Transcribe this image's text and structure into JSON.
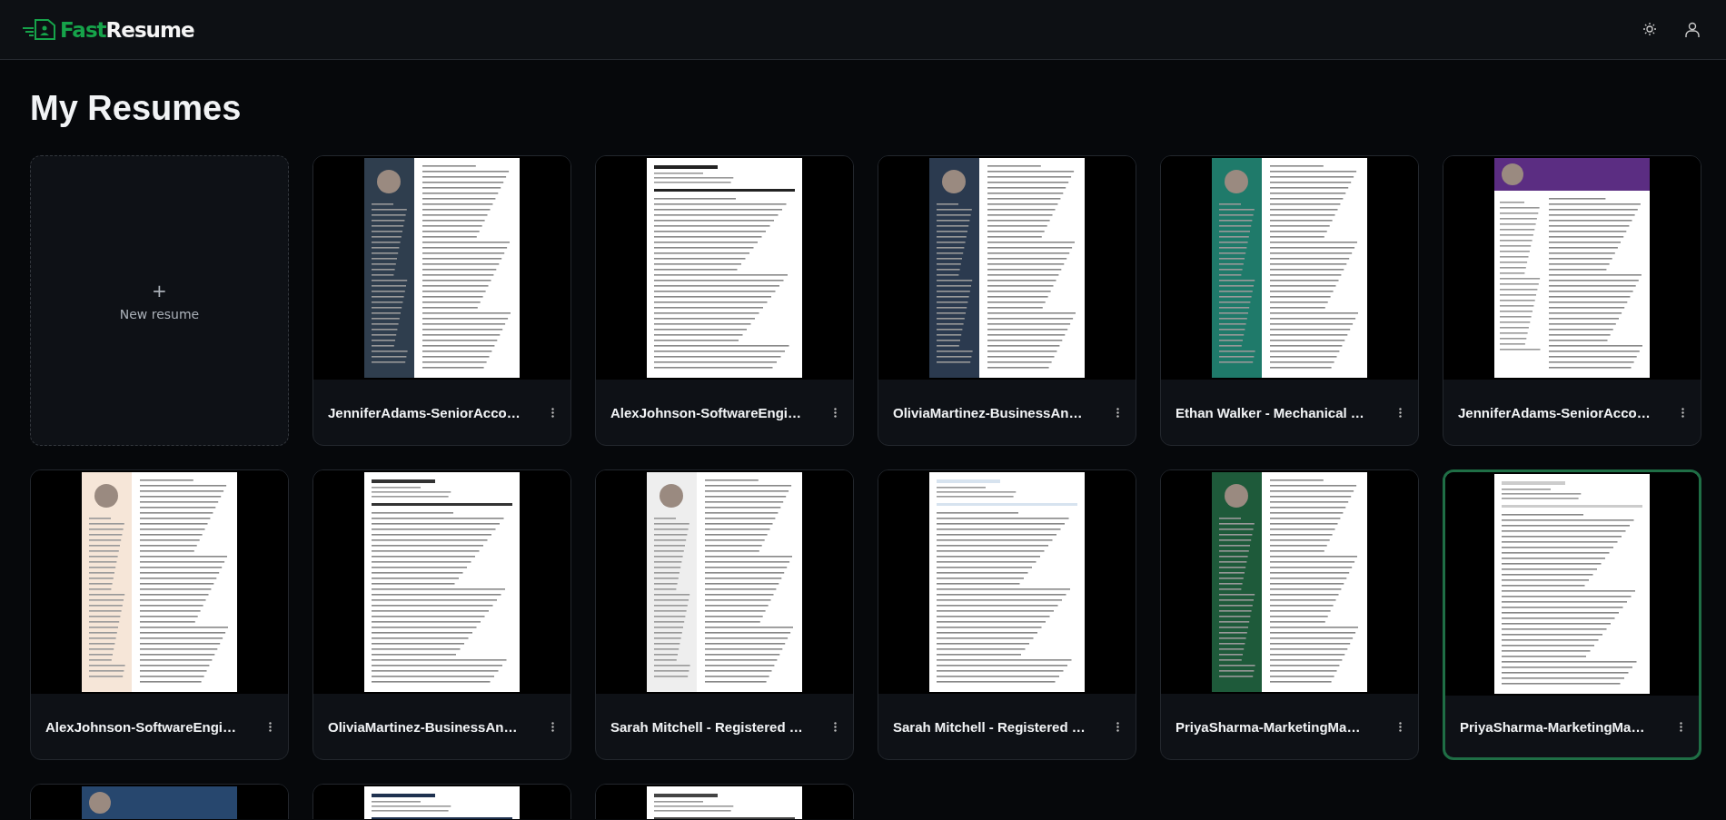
{
  "app": {
    "logo_part_1": "Fast",
    "logo_part_2": "Resume"
  },
  "page": {
    "title": "My Resumes"
  },
  "new_card": {
    "plus": "+",
    "label": "New resume"
  },
  "resumes": [
    {
      "title": "JenniferAdams-SeniorAcco…",
      "kind": "sidebar",
      "color": "#2f3e4e",
      "selected": false
    },
    {
      "title": "AlexJohnson-SoftwareEngi…",
      "kind": "plain",
      "color": "#222222",
      "selected": false
    },
    {
      "title": "OliviaMartinez-BusinessAn…",
      "kind": "sidebar",
      "color": "#2b3a4f",
      "selected": false
    },
    {
      "title": "Ethan Walker - Mechanical …",
      "kind": "sidebar",
      "color": "#1f7a6a",
      "selected": false
    },
    {
      "title": "JenniferAdams-SeniorAcco…",
      "kind": "header",
      "color": "#5b2d82",
      "selected": false
    },
    {
      "title": "AlexJohnson-SoftwareEngi…",
      "kind": "sidebar",
      "color": "#f6e6d8",
      "selected": false
    },
    {
      "title": "OliviaMartinez-BusinessAn…",
      "kind": "plain",
      "color": "#333333",
      "selected": false
    },
    {
      "title": "Sarah Mitchell - Registered …",
      "kind": "sidebar",
      "color": "#eeeeee",
      "selected": false
    },
    {
      "title": "Sarah Mitchell - Registered …",
      "kind": "plain",
      "color": "#d7e3ef",
      "selected": false
    },
    {
      "title": "PriyaSharma-MarketingMa…",
      "kind": "sidebar",
      "color": "#1e5a3a",
      "selected": false
    },
    {
      "title": "PriyaSharma-MarketingMa…",
      "kind": "plain",
      "color": "#cccccc",
      "selected": true
    },
    {
      "kind": "header",
      "color": "#27476e",
      "selected": false
    },
    {
      "kind": "plain",
      "color": "#1f3250",
      "selected": false
    },
    {
      "kind": "plain",
      "color": "#444444",
      "selected": false
    }
  ]
}
